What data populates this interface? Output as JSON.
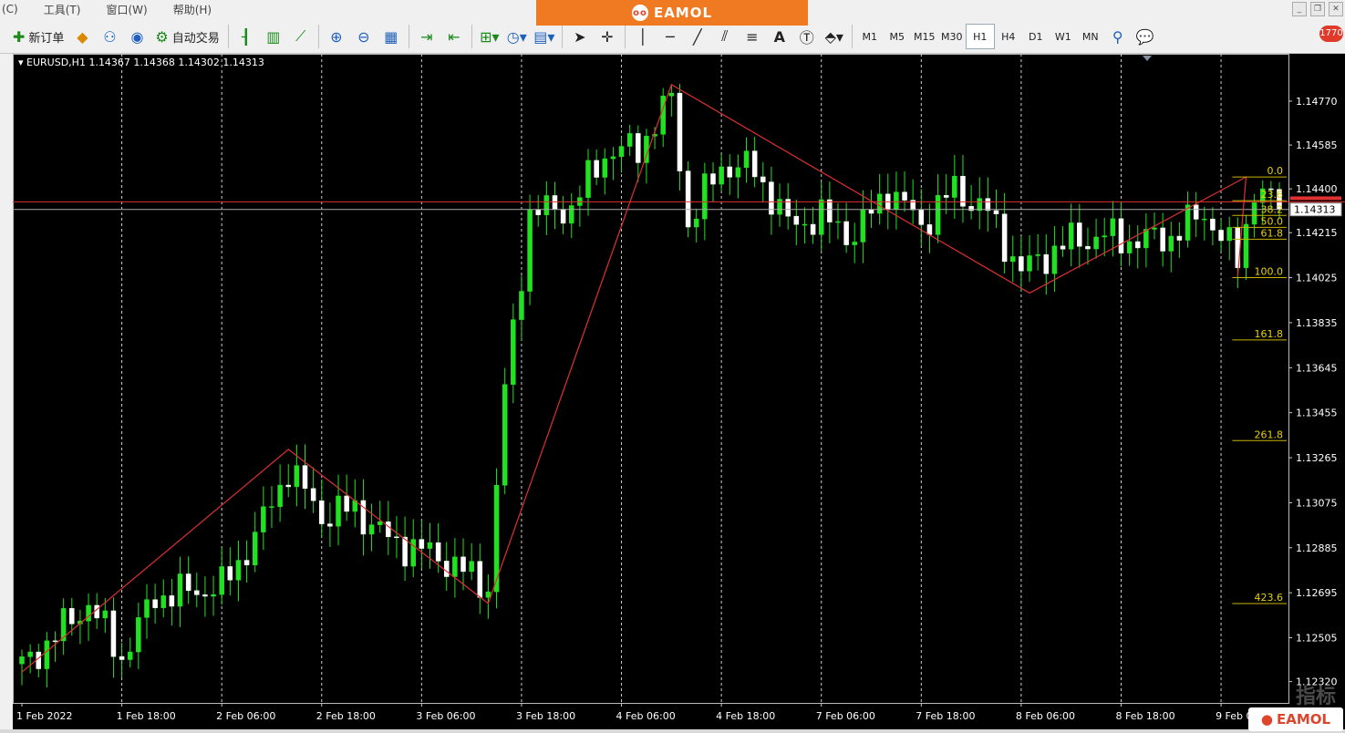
{
  "menu": {
    "items": [
      "(C)",
      "工具(T)",
      "窗口(W)",
      "帮助(H)"
    ]
  },
  "brand": {
    "label": "EAMOL"
  },
  "toolbar": {
    "new_order": "新订单",
    "auto_trading": "自动交易",
    "timeframes": [
      "M1",
      "M5",
      "M15",
      "M30",
      "H1",
      "H4",
      "D1",
      "W1",
      "MN"
    ],
    "active_timeframe": "H1",
    "notification_count": "1770"
  },
  "chart": {
    "symbol_info": "EURUSD,H1  1.14367 1.14368 1.14302 1.14313",
    "current_price": "1.14313"
  },
  "chart_data": {
    "type": "candlestick",
    "symbol": "EURUSD",
    "timeframe": "H1",
    "ylim": [
      1.1223,
      1.1497
    ],
    "y_ticks": [
      1.1477,
      1.14585,
      1.144,
      1.14215,
      1.14025,
      1.13835,
      1.13645,
      1.13455,
      1.13265,
      1.13075,
      1.12885,
      1.12695,
      1.12505,
      1.1232
    ],
    "y_tick_labels": [
      "1.14770",
      "1.14585",
      "1.14400",
      "1.14215",
      "1.14025",
      "1.13835",
      "1.13645",
      "1.13455",
      "1.13265",
      "1.13075",
      "1.12885",
      "1.12695",
      "1.12505",
      "1.12320"
    ],
    "x_labels": [
      "1 Feb 2022",
      "1 Feb 18:00",
      "2 Feb 06:00",
      "2 Feb 18:00",
      "3 Feb 06:00",
      "3 Feb 18:00",
      "4 Feb 06:00",
      "4 Feb 18:00",
      "7 Feb 06:00",
      "7 Feb 18:00",
      "8 Feb 06:00",
      "8 Feb 18:00",
      "9 Feb 06:00"
    ],
    "x_label_positions": [
      0,
      12,
      24,
      36,
      48,
      60,
      72,
      84,
      96,
      108,
      120,
      132,
      144
    ],
    "bar_count": 152,
    "zigzag": [
      [
        0,
        1.1236
      ],
      [
        32,
        1.133
      ],
      [
        56,
        1.1265
      ],
      [
        78,
        1.1484
      ],
      [
        121,
        1.1396
      ],
      [
        147,
        1.1445
      ],
      [
        146,
        1.1403
      ],
      [
        147,
        1.1445
      ]
    ],
    "fibonacci": {
      "high": 1.1445,
      "low": 1.14025,
      "levels": [
        "0.0",
        "23.6",
        "38.2",
        "50.0",
        "61.8",
        "100.0",
        "161.8",
        "261.8",
        "423.6"
      ]
    },
    "horizontal_lines": [
      1.14345,
      1.14313
    ],
    "anchor_closes": [
      [
        0,
        1.1238
      ],
      [
        8,
        1.1265
      ],
      [
        12,
        1.1242
      ],
      [
        16,
        1.1268
      ],
      [
        24,
        1.1272
      ],
      [
        28,
        1.1293
      ],
      [
        32,
        1.1322
      ],
      [
        36,
        1.1302
      ],
      [
        40,
        1.1305
      ],
      [
        44,
        1.1292
      ],
      [
        50,
        1.1285
      ],
      [
        56,
        1.1272
      ],
      [
        58,
        1.1355
      ],
      [
        61,
        1.143
      ],
      [
        66,
        1.1432
      ],
      [
        70,
        1.1455
      ],
      [
        74,
        1.1457
      ],
      [
        78,
        1.1478
      ],
      [
        80,
        1.1425
      ],
      [
        84,
        1.145
      ],
      [
        88,
        1.1448
      ],
      [
        92,
        1.1425
      ],
      [
        96,
        1.1428
      ],
      [
        100,
        1.142
      ],
      [
        104,
        1.144
      ],
      [
        108,
        1.1425
      ],
      [
        112,
        1.144
      ],
      [
        116,
        1.143
      ],
      [
        120,
        1.1405
      ],
      [
        122,
        1.141
      ],
      [
        126,
        1.1418
      ],
      [
        130,
        1.142
      ],
      [
        134,
        1.1418
      ],
      [
        138,
        1.142
      ],
      [
        142,
        1.143
      ],
      [
        144,
        1.142
      ],
      [
        146,
        1.141
      ],
      [
        148,
        1.144
      ],
      [
        151,
        1.14313
      ]
    ]
  }
}
